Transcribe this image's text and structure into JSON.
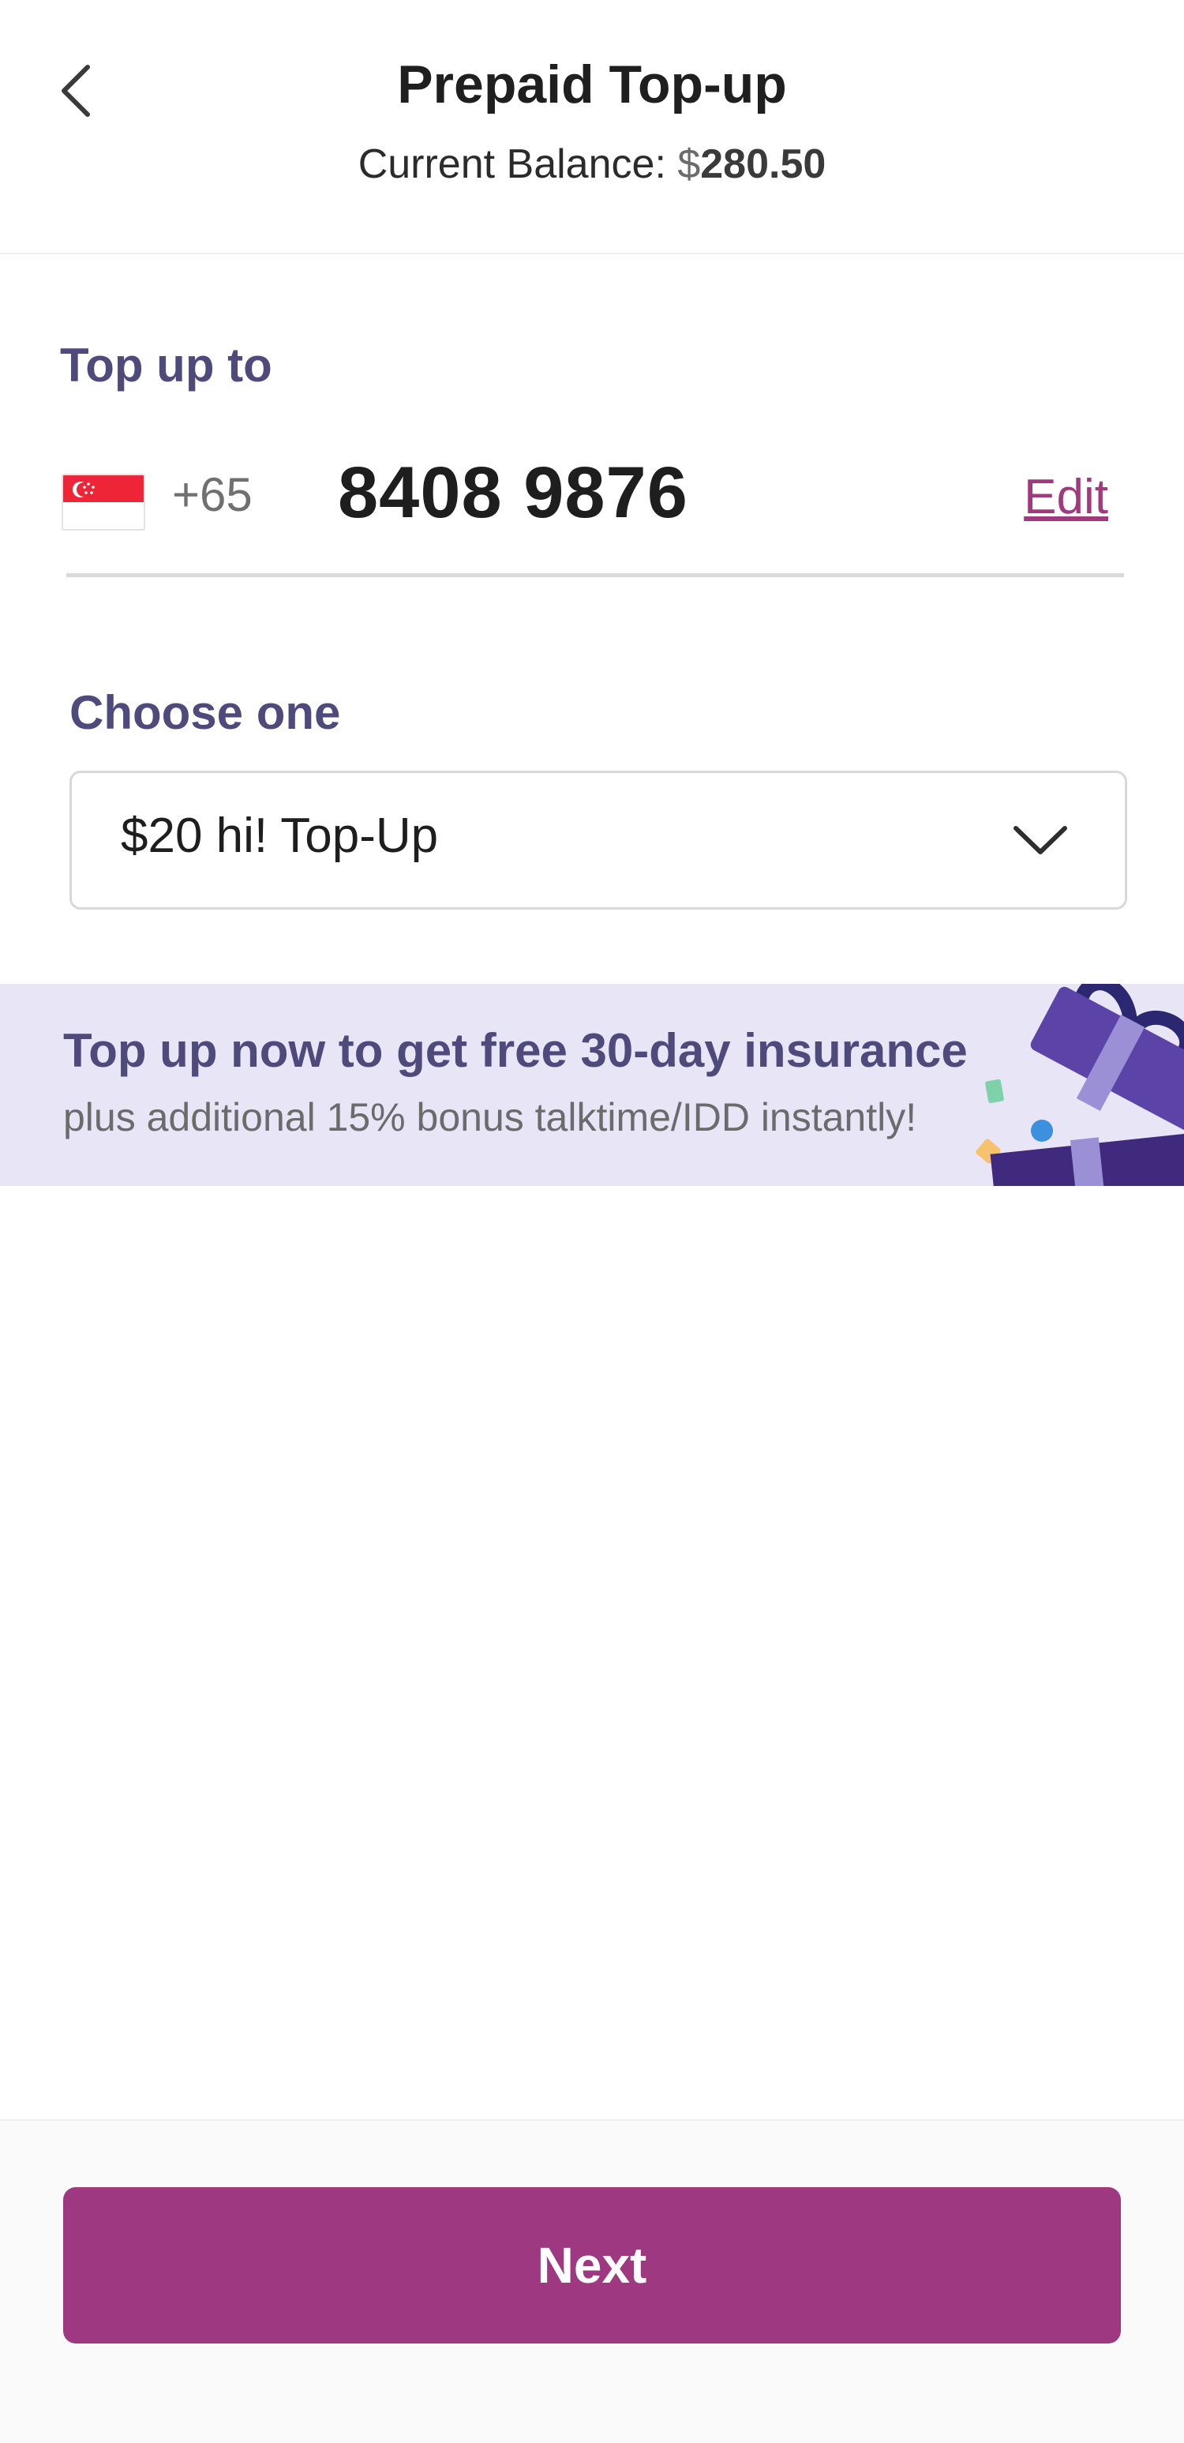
{
  "header": {
    "title": "Prepaid Top-up",
    "balance_label": "Current Balance: ",
    "balance_currency": "$",
    "balance_amount": "280.50",
    "back_icon": "chevron-left-icon"
  },
  "topup_to": {
    "label": "Top up to",
    "country_flag_icon": "singapore-flag-icon",
    "country_code": "+65",
    "phone_number": "8408 9876",
    "edit_label": "Edit"
  },
  "plan_select": {
    "label": "Choose one",
    "selected_value": "$20 hi! Top-Up",
    "chevron_icon": "chevron-down-icon"
  },
  "promo": {
    "title": "Top up now to get free 30-day insurance",
    "subtitle": "plus additional 15% bonus talktime/IDD instantly!",
    "art_icon": "gift-box-icon"
  },
  "footer": {
    "next_label": "Next"
  },
  "colors": {
    "accent": "#9e3880",
    "label_purple": "#4e4a7c",
    "promo_bg": "#e8e5f7"
  }
}
